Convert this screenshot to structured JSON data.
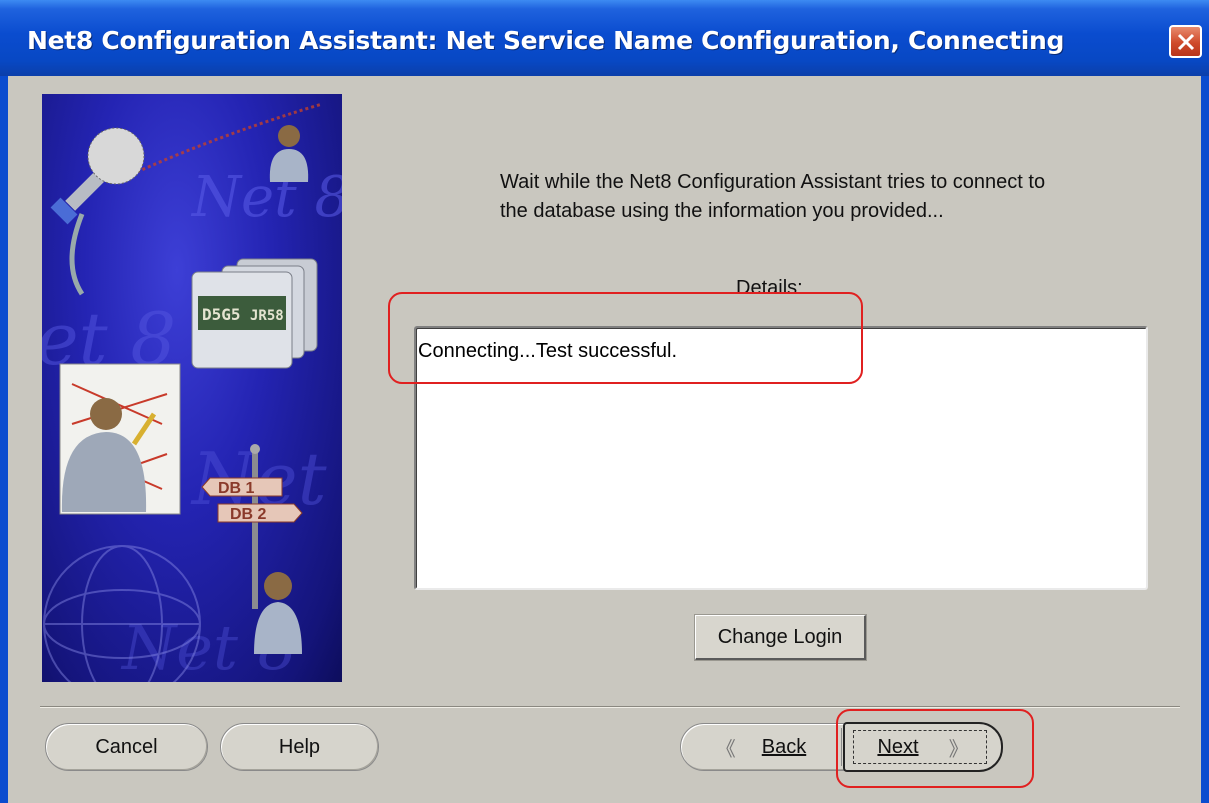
{
  "window": {
    "title": "Net8 Configuration Assistant: Net Service Name Configuration, Connecting"
  },
  "illustration": {
    "watermarks": [
      "Net 8",
      "et 8",
      "Net 8",
      "Net 8"
    ],
    "folder_label": "D5G5",
    "folder_label2": "JR58",
    "signs": [
      "DB 1",
      "DB 2"
    ]
  },
  "main": {
    "instructions": "Wait while the Net8 Configuration Assistant tries to connect to the database using the information you provided...",
    "details_label": "Details:",
    "details_text": "Connecting...Test successful.",
    "change_login_label": "Change Login"
  },
  "footer": {
    "cancel_label": "Cancel",
    "help_label": "Help",
    "back_label": "Back",
    "next_label": "Next"
  },
  "colors": {
    "titlebar": "#0a4ccf",
    "panel_bg": "#c9c7bf",
    "annotation": "#e02020",
    "close_button": "#cf4a2a"
  }
}
